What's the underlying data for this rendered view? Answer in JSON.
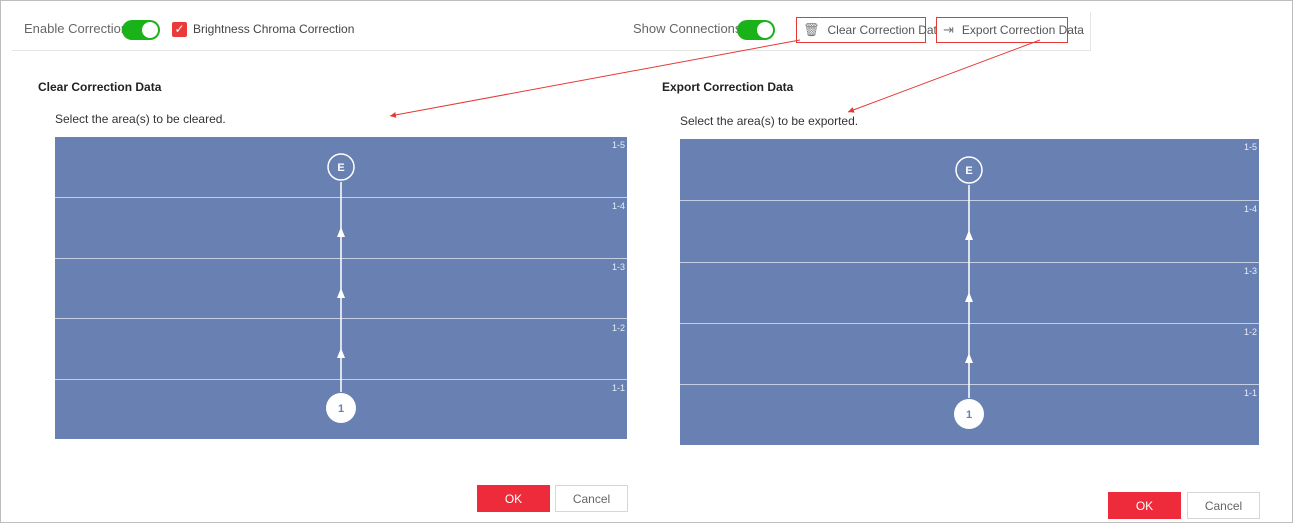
{
  "toolbar": {
    "enable_correction_label": "Enable Correction",
    "enable_correction_on": true,
    "brightness_chroma_label": "Brightness Chroma Correction",
    "brightness_chroma_checked": true,
    "show_connections_label": "Show Connections",
    "show_connections_on": true,
    "clear_button_label": "Clear Correction Data",
    "export_button_label": "Export Correction Data",
    "clear_icon": "trash-icon",
    "export_icon": "export-icon"
  },
  "clear_panel": {
    "title": "Clear Correction Data",
    "instruction": "Select the area(s) to be cleared.",
    "zones": [
      "1-5",
      "1-4",
      "1-3",
      "1-2",
      "1-1"
    ],
    "start_marker": "1",
    "end_marker": "E",
    "ok_label": "OK",
    "cancel_label": "Cancel"
  },
  "export_panel": {
    "title": "Export Correction Data",
    "instruction": "Select the area(s) to be exported.",
    "zones": [
      "1-5",
      "1-4",
      "1-3",
      "1-2",
      "1-1"
    ],
    "start_marker": "1",
    "end_marker": "E",
    "ok_label": "OK",
    "cancel_label": "Cancel"
  },
  "colors": {
    "toggle_on": "#19b219",
    "accent_red": "#ee2b3b",
    "grid_fill": "#6880b2",
    "annotation_red": "#e53935"
  }
}
